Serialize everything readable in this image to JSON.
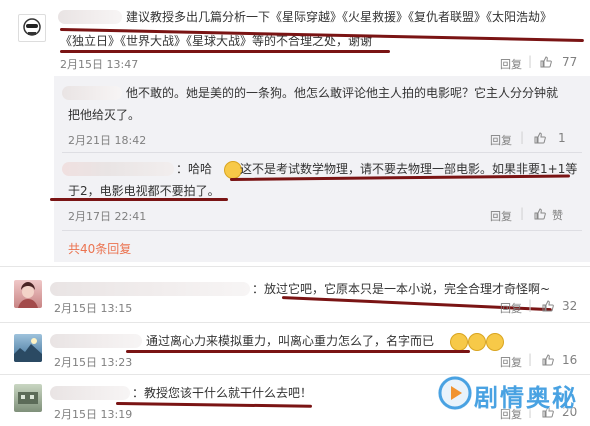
{
  "comment1": {
    "text_line1": "建议教授多出几篇分析一下《星际穿越》《火星救援》《复仇者联盟》《太阳浩劫》",
    "text_line2": "《独立日》《世界大战》《星球大战》等的不合理之处，谢谢",
    "date": "2月15日 13:47",
    "reply_label": "回复",
    "likes": "77"
  },
  "reply1": {
    "text_line1": "他不敢的。她是美的的一条狗。他怎么敢评论他主人拍的电影呢？它主人分分钟就",
    "text_line2": "把他给灭了。",
    "date": "2月21日 18:42",
    "reply_label": "回复",
    "likes": "1"
  },
  "reply2": {
    "prefix": "：哈哈",
    "text_line1": "这不是考试数学物理，请不要去物理一部电影。如果非要1+1等",
    "text_line2": "于2，电影电视都不要拍了。",
    "date": "2月17日 22:41",
    "reply_label": "回复",
    "likes": "赞"
  },
  "more_replies": "共40条回复",
  "comment2": {
    "text": "：放过它吧，它原本只是一本小说，完全合理才奇怪啊~",
    "date": "2月15日 13:15",
    "reply_label": "回复",
    "likes": "32"
  },
  "comment3": {
    "text": "通过离心力来模拟重力，叫离心重力怎么了，名字而已",
    "date": "2月15日 13:23",
    "reply_label": "回复",
    "likes": "16"
  },
  "comment4": {
    "text": "：教授您该干什么就干什么去吧！",
    "date": "2月15日 13:19",
    "reply_label": "回复",
    "likes": "20"
  },
  "watermark": "剧情奥秘",
  "colors": {
    "underline": "#7a1414",
    "link": "#eb7350",
    "reply_bg": "#f2f2f5"
  }
}
